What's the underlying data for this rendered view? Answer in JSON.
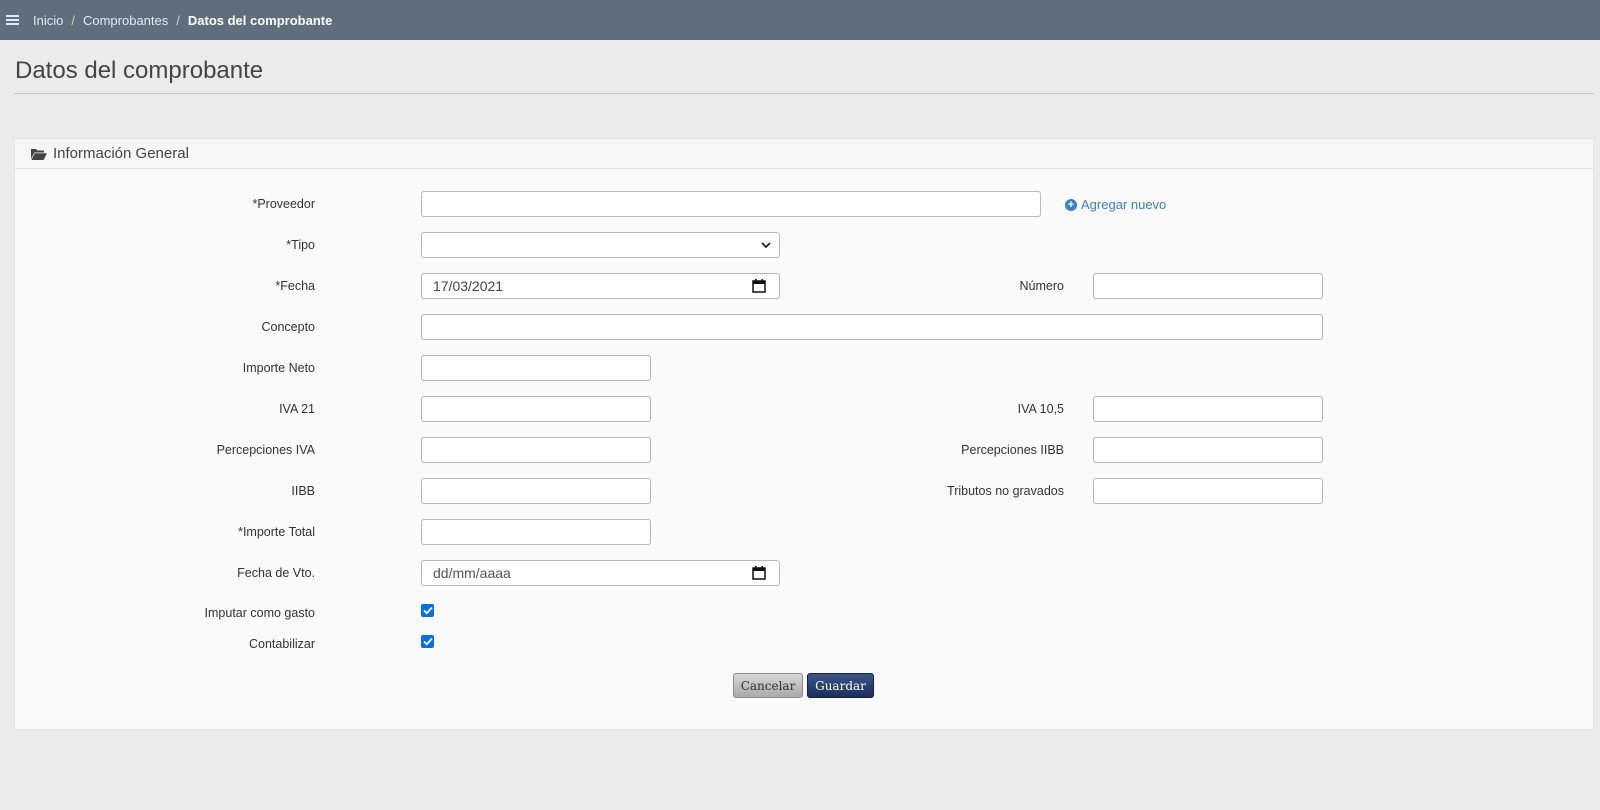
{
  "breadcrumb": {
    "items": [
      "Inicio",
      "Comprobantes"
    ],
    "separator": "/",
    "current": "Datos del comprobante"
  },
  "page": {
    "title": "Datos del comprobante"
  },
  "panel": {
    "title": "Información General"
  },
  "form": {
    "proveedor_label": "*Proveedor",
    "proveedor_value": "",
    "agregar_nuevo": "Agregar nuevo",
    "tipo_label": "*Tipo",
    "tipo_value": "",
    "fecha_label": "*Fecha",
    "fecha_value": "17/03/2021",
    "numero_label": "Número",
    "numero_value": "",
    "concepto_label": "Concepto",
    "concepto_value": "",
    "importe_neto_label": "Importe Neto",
    "importe_neto_value": "",
    "iva21_label": "IVA 21",
    "iva21_value": "",
    "iva105_label": "IVA 10,5",
    "iva105_value": "",
    "perc_iva_label": "Percepciones IVA",
    "perc_iva_value": "",
    "perc_iibb_label": "Percepciones IIBB",
    "perc_iibb_value": "",
    "iibb_label": "IIBB",
    "iibb_value": "",
    "tributos_label": "Tributos no gravados",
    "tributos_value": "",
    "importe_total_label": "*Importe Total",
    "importe_total_value": "",
    "fecha_vto_label": "Fecha de Vto.",
    "fecha_vto_placeholder": "dd/mm/aaaa",
    "imputar_label": "Imputar como gasto",
    "imputar_checked": true,
    "contabilizar_label": "Contabilizar",
    "contabilizar_checked": true
  },
  "buttons": {
    "cancel": "Cancelar",
    "save": "Guardar"
  },
  "colors": {
    "topbar": "#5f6e7d",
    "link": "#3b7fc4",
    "checkbox": "#0b6fe0",
    "primary_button": "#1c2f5a"
  },
  "icons": [
    "menu-icon",
    "folder-open-icon",
    "plus-circle-icon",
    "calendar-icon",
    "chevron-down-icon",
    "check-icon"
  ]
}
